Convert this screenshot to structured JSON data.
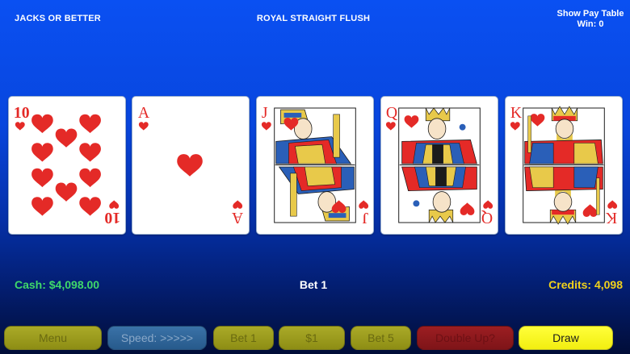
{
  "header": {
    "game_name": "JACKS OR BETTER",
    "hand_result": "ROYAL STRAIGHT FLUSH",
    "pay_table_label": "Show Pay Table",
    "win_label": "Win: 0"
  },
  "cards": [
    {
      "rank": "10",
      "suit": "hearts",
      "suit_color": "#e42a27"
    },
    {
      "rank": "A",
      "suit": "hearts",
      "suit_color": "#e42a27"
    },
    {
      "rank": "J",
      "suit": "hearts",
      "suit_color": "#e42a27"
    },
    {
      "rank": "Q",
      "suit": "hearts",
      "suit_color": "#e42a27"
    },
    {
      "rank": "K",
      "suit": "hearts",
      "suit_color": "#e42a27"
    }
  ],
  "status": {
    "cash": "Cash: $4,098.00",
    "bet": "Bet 1",
    "credits": "Credits: 4,098"
  },
  "buttons": {
    "menu": "Menu",
    "speed": "Speed: >>>>>",
    "bet1": "Bet 1",
    "denomination": "$1",
    "bet5": "Bet 5",
    "double_up": "Double Up?",
    "draw": "Draw"
  },
  "colors": {
    "cash_text": "#3fd86a",
    "credits_text": "#f2d21b",
    "hearts": "#e42a27",
    "draw_button": "#ffff3a"
  }
}
